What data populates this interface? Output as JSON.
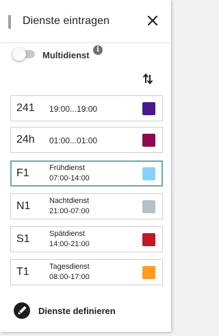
{
  "header": {
    "title": "Dienste eintragen"
  },
  "multidienst": {
    "label": "Multidienst",
    "info_glyph": "i",
    "enabled": false
  },
  "shifts": [
    {
      "code": "241",
      "name": "",
      "time": "19:00...19:00",
      "color": "#4a1a8c",
      "selected": false
    },
    {
      "code": "24h",
      "name": "",
      "time": "01:00...01:00",
      "color": "#8c0a4e",
      "selected": false
    },
    {
      "code": "F1",
      "name": "Frühdienst",
      "time": "07:00-14:00",
      "color": "#87d3f8",
      "selected": true
    },
    {
      "code": "N1",
      "name": "Nachtdienst",
      "time": "21:00-07:00",
      "color": "#b6c0c6",
      "selected": false
    },
    {
      "code": "S1",
      "name": "Spätdienst",
      "time": "14:00-21:00",
      "color": "#c01a25",
      "selected": false
    },
    {
      "code": "T1",
      "name": "Tagesdienst",
      "time": "08:00-17:00",
      "color": "#fa9c28",
      "selected": false
    }
  ],
  "footer": {
    "define_label": "Dienste definieren"
  },
  "icons": {
    "drag": "drag-handle-icon",
    "close": "close-icon",
    "info": "info-icon",
    "sort": "sort-icon",
    "pencil": "pencil-icon"
  },
  "colors": {
    "selected_border": "#6fa9a4"
  }
}
